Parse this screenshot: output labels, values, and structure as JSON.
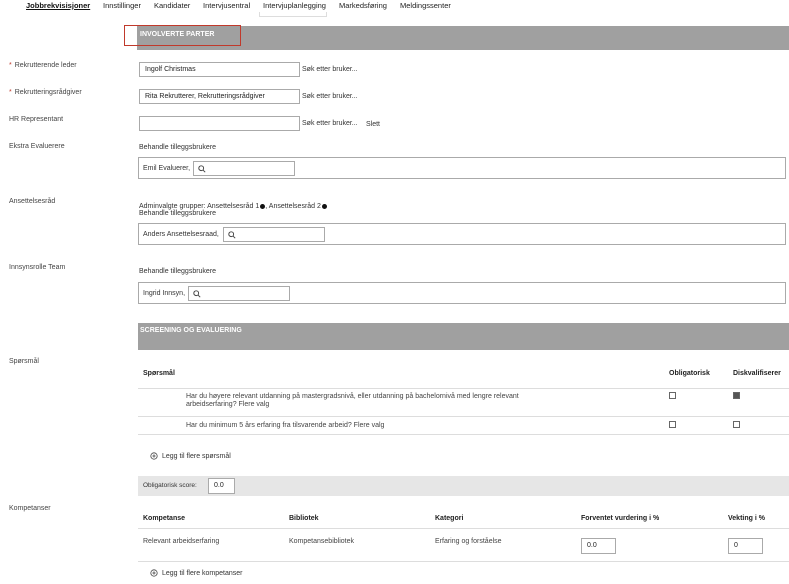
{
  "nav": {
    "tabs": [
      "Jobbrekvisisjoner",
      "Innstillinger",
      "Kandidater",
      "Intervjusentral",
      "Intervjuplanlegging",
      "Markedsføring",
      "Meldingssenter"
    ]
  },
  "involverte": {
    "title": "INVOLVERTE PARTER",
    "recruiting_manager": {
      "label": "Rekrutterende leder",
      "value": "Ingolf Christmas",
      "search": "Søk etter bruker..."
    },
    "recruiter": {
      "label": "Rekrutteringsrådgiver",
      "value": "Rita Rekrutterer, Rekrutteringsrådgiver",
      "search": "Søk etter bruker..."
    },
    "hr": {
      "label": "HR Representant",
      "value": "",
      "search": "Søk etter bruker...",
      "delete": "Slett"
    },
    "extra_eval": {
      "label": "Ekstra Evaluerere",
      "manage": "Behandle tilleggsbrukere",
      "chip": "Emil Evaluerer,"
    },
    "board": {
      "label": "Ansettelsesråd",
      "groups_prefix": "Adminvalgte grupper:",
      "group1": "Ansettelsesråd 1",
      "group2": ", Ansettelsesråd 2",
      "manage": "Behandle tilleggsbrukere",
      "chip": "Anders Ansettelsesraad,"
    },
    "insight": {
      "label": "Innsynsrolle Team",
      "manage": "Behandle tilleggsbrukere",
      "chip": "Ingrid Innsyn,"
    }
  },
  "screening": {
    "title": "SCREENING OG EVALUERING",
    "questions_label": "Spørsmål",
    "col_question": "Spørsmål",
    "col_mandatory": "Obligatorisk",
    "col_disq": "Diskvalifiserer",
    "questions": [
      {
        "text": "Har du høyere relevant utdanning på mastergradsnivå, eller utdanning på bachelornivå med lengre relevant arbeidserfaring?  Flere valg",
        "mandatory": false,
        "disq": true
      },
      {
        "text": "Har du minimum 5 års erfaring fra tilsvarende arbeid?  Flere valg",
        "mandatory": false,
        "disq": false
      }
    ],
    "add_question": "Legg til flere spørsmål",
    "score_label": "Obligatorisk score:",
    "score_value": "0.0"
  },
  "competence": {
    "label": "Kompetanser",
    "headers": {
      "name": "Kompetanse",
      "library": "Bibliotek",
      "category": "Kategori",
      "expected": "Forventet vurdering i %",
      "weight": "Vekting i %"
    },
    "rows": [
      {
        "name": "Relevant arbeidserfaring",
        "library": "Kompetansebibliotek",
        "category": "Erfaring og forståelse",
        "expected": "0.0",
        "weight": "0"
      }
    ],
    "add": "Legg til flere kompetanser"
  }
}
